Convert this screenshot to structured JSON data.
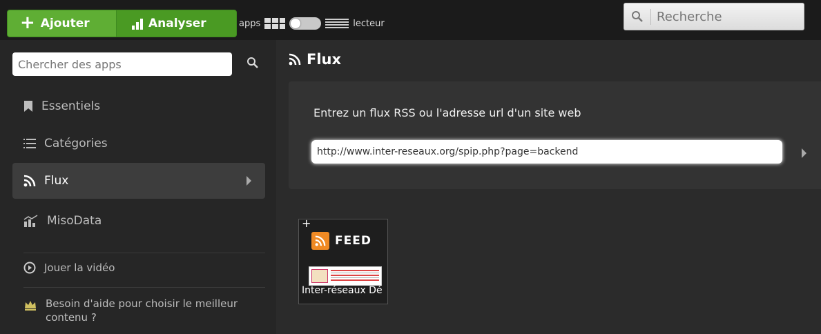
{
  "topbar": {
    "add_label": "Ajouter",
    "analyze_label": "Analyser",
    "view_apps_label": "apps",
    "view_reader_label": "lecteur",
    "search_placeholder": "Recherche"
  },
  "sidebar": {
    "search_placeholder": "Chercher des apps",
    "items": [
      {
        "label": "Essentiels",
        "icon": "bookmark-icon"
      },
      {
        "label": "Catégories",
        "icon": "list-icon"
      },
      {
        "label": "Flux",
        "icon": "rss-icon",
        "active": true
      },
      {
        "label": "MisoData",
        "icon": "chart-icon"
      }
    ],
    "play_video_label": "Jouer la vidéo",
    "help_text": "Besoin d'aide pour choisir le meilleur contenu ?"
  },
  "main": {
    "title": "Flux",
    "rss_label": "Entrez un flux RSS ou l'adresse url d'un site web",
    "rss_value": "http://www.inter-reseaux.org/spip.php?page=backend",
    "card": {
      "badge": "FEED",
      "caption": "Inter-réseaux Dé"
    }
  },
  "colors": {
    "accent_green": "#5fae34",
    "background": "#2b2b2b",
    "rss_orange": "#f08a24"
  }
}
